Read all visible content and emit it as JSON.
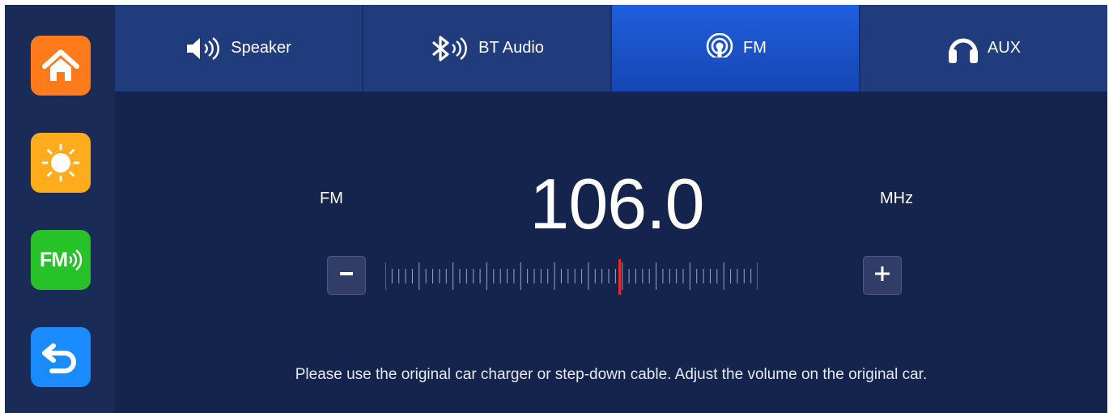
{
  "sidebar": {
    "items": [
      {
        "name": "home",
        "icon": "home-icon",
        "color": "#ff7a1a"
      },
      {
        "name": "brightness",
        "icon": "sun-icon",
        "color": "#ffac1c"
      },
      {
        "name": "fm",
        "icon": "fm-icon",
        "label": "FM",
        "color": "#27c22a"
      },
      {
        "name": "back",
        "icon": "back-arrow-icon",
        "color": "#1a8cff"
      }
    ]
  },
  "tabs": [
    {
      "label": "Speaker",
      "icon": "speaker-icon",
      "active": false
    },
    {
      "label": "BT Audio",
      "icon": "bluetooth-icon",
      "active": false
    },
    {
      "label": "FM",
      "icon": "radio-broadcast-icon",
      "active": true
    },
    {
      "label": "AUX",
      "icon": "headphones-icon",
      "active": false
    }
  ],
  "radio": {
    "band": "FM",
    "frequency": "106.0",
    "unit": "MHz",
    "decrease_label": "−",
    "increase_label": "+"
  },
  "notice": "Please use the original car charger or step-down cable. Adjust the volume on the original car.",
  "colors": {
    "background": "#14244d",
    "tab": "#213c7c",
    "tab_active": "#1f5fdc",
    "indicator": "#e8262b"
  }
}
